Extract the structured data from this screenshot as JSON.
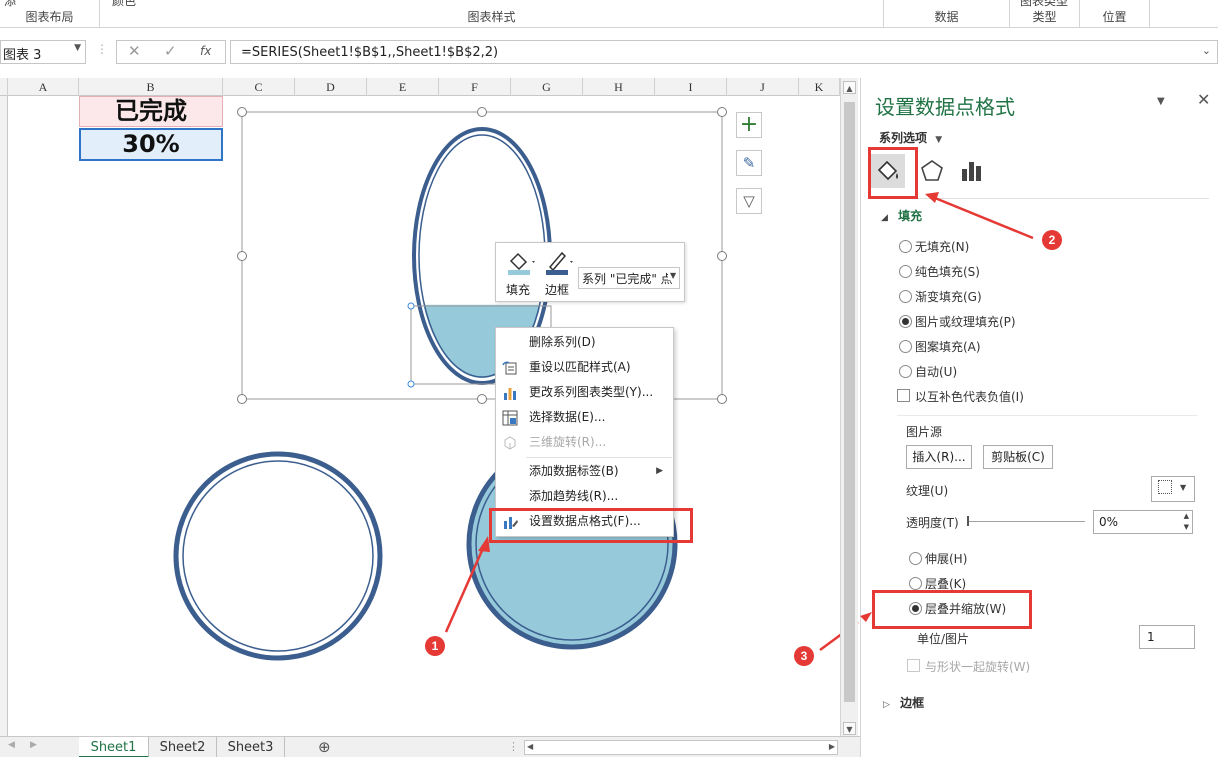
{
  "ribbon": {
    "groups": [
      {
        "label": "图表布局",
        "cut": "添"
      },
      {
        "label": "图表样式",
        "cut": "颜色"
      },
      {
        "label": "数据"
      },
      {
        "label": "类型",
        "cut": "图表类型"
      },
      {
        "label": "位置"
      }
    ]
  },
  "formula_bar": {
    "name_box": "图表 3",
    "formula": "=SERIES(Sheet1!$B$1,,Sheet1!$B$2,2)",
    "fx": "fx"
  },
  "sheet": {
    "columns": [
      "A",
      "B",
      "C",
      "D",
      "E",
      "F",
      "G",
      "H",
      "I",
      "J",
      "K"
    ],
    "b1": "已完成",
    "b2": "30%",
    "tabs": [
      "Sheet1",
      "Sheet2",
      "Sheet3"
    ],
    "add_sheet": "⊕"
  },
  "chart": {
    "fill_percent": 0.3
  },
  "mini_toolbar": {
    "fill": "填充",
    "outline": "边框",
    "series_selector": "系列 \"已完成\" 点"
  },
  "context_menu": {
    "items": [
      {
        "label": "删除系列(D)",
        "enabled": true
      },
      {
        "label": "重设以匹配样式(A)",
        "enabled": true
      },
      {
        "label": "更改系列图表类型(Y)...",
        "enabled": true
      },
      {
        "label": "选择数据(E)...",
        "enabled": true
      },
      {
        "label": "三维旋转(R)...",
        "enabled": false
      },
      {
        "label": "添加数据标签(B)",
        "enabled": true,
        "submenu": true
      },
      {
        "label": "添加趋势线(R)...",
        "enabled": true
      },
      {
        "label": "设置数据点格式(F)...",
        "enabled": true
      }
    ]
  },
  "pane": {
    "title": "设置数据点格式",
    "series_options": "系列选项",
    "fill_section": "填充",
    "fill_options": [
      {
        "label": "无填充(N)",
        "checked": false
      },
      {
        "label": "纯色填充(S)",
        "checked": false
      },
      {
        "label": "渐变填充(G)",
        "checked": false
      },
      {
        "label": "图片或纹理填充(P)",
        "checked": true
      },
      {
        "label": "图案填充(A)",
        "checked": false
      },
      {
        "label": "自动(U)",
        "checked": false
      }
    ],
    "invert_negative": "以互补色代表负值(I)",
    "picture_source": "图片源",
    "insert_button": "插入(R)...",
    "clipboard_button": "剪贴板(C)",
    "texture_label": "纹理(U)",
    "transparency_label": "透明度(T)",
    "transparency_value": "0%",
    "stretch_options": [
      {
        "label": "伸展(H)",
        "checked": false
      },
      {
        "label": "层叠(K)",
        "checked": false
      },
      {
        "label": "层叠并缩放(W)",
        "checked": true
      }
    ],
    "units_label": "单位/图片",
    "units_value": "1",
    "rotate_with_shape": "与形状一起旋转(W)",
    "border_section": "边框"
  },
  "annotations": [
    "1",
    "2",
    "3"
  ],
  "colors": {
    "accent_green": "#217346",
    "ring_blue": "#3b5e8f",
    "fill_light_blue": "#96cadb",
    "annotation_red": "#e53935"
  }
}
